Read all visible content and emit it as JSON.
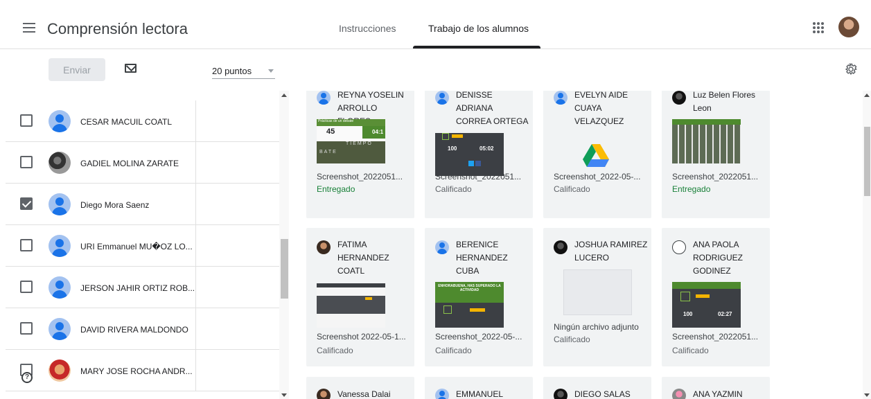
{
  "header": {
    "title": "Comprensión lectora",
    "tabs": [
      {
        "label": "Instrucciones"
      },
      {
        "label": "Trabajo de los alumnos"
      }
    ]
  },
  "toolbar": {
    "send_label": "Enviar",
    "points_value": "20 puntos"
  },
  "students": [
    {
      "name": "CESAR MACUIL COATL",
      "checked": false
    },
    {
      "name": "GADIEL MOLINA ZARATE",
      "checked": false
    },
    {
      "name": "Diego Mora Saenz",
      "checked": true
    },
    {
      "name": "URI Emmanuel MU�OZ LO...",
      "checked": false
    },
    {
      "name": "JERSON JAHIR ORTIZ ROB...",
      "checked": false
    },
    {
      "name": "DAVID RIVERA MALDONDO",
      "checked": false
    },
    {
      "name": "MARY JOSE ROCHA ANDR...",
      "checked": false
    }
  ],
  "cards": [
    {
      "name": "REYNA YOSELIN ARROLLO FLORES",
      "file": "Screenshot_2022051...",
      "status": "Entregado",
      "thumb_text_1": "Prácticas de un debate",
      "thumb_text_2": "45",
      "thumb_text_3": "04:1",
      "thumb_text_4": "TIEMPO",
      "thumb_text_5": "BATE"
    },
    {
      "name": "DENISSE ADRIANA CORREA ORTEGA",
      "file": "Screenshot_2022051...",
      "status": "Calificado",
      "thumb_text_1": "100",
      "thumb_text_2": "05:02"
    },
    {
      "name": "EVELYN AIDE CUAYA VELAZQUEZ",
      "file": "Screenshot_2022-05-...",
      "status": "Calificado"
    },
    {
      "name": "Luz Belen Flores Leon",
      "file": "Screenshot_2022051...",
      "status": "Entregado"
    },
    {
      "name": "FATIMA HERNANDEZ COATL",
      "file": "Screenshot 2022-05-1...",
      "status": "Calificado"
    },
    {
      "name": "BERENICE HERNANDEZ CUBA",
      "file": "Screenshot_2022-05-...",
      "status": "Calificado",
      "thumb_text_1": "ENHORABUENA, HAS SUPERADO LA ACTIVIDAD"
    },
    {
      "name": "JOSHUA RAMIREZ LUCERO",
      "file": "Ningún archivo adjunto",
      "status": "Calificado"
    },
    {
      "name": "ANA PAOLA RODRIGUEZ GODINEZ",
      "file": "Screenshot_2022051...",
      "status": "Calificado",
      "thumb_text_1": "100",
      "thumb_text_2": "02:27"
    },
    {
      "name": "Vanessa Dalai"
    },
    {
      "name": "EMMANUEL"
    },
    {
      "name": "DIEGO SALAS"
    },
    {
      "name": "ANA YAZMIN"
    }
  ],
  "colors": {
    "accent_blue": "#1a73e8",
    "status_green": "#188038",
    "card_bg": "#f1f3f4"
  },
  "icons": [
    "menu-icon",
    "mail-icon",
    "settings-gear-icon",
    "google-apps-icon",
    "google-drive-icon",
    "help-icon"
  ]
}
